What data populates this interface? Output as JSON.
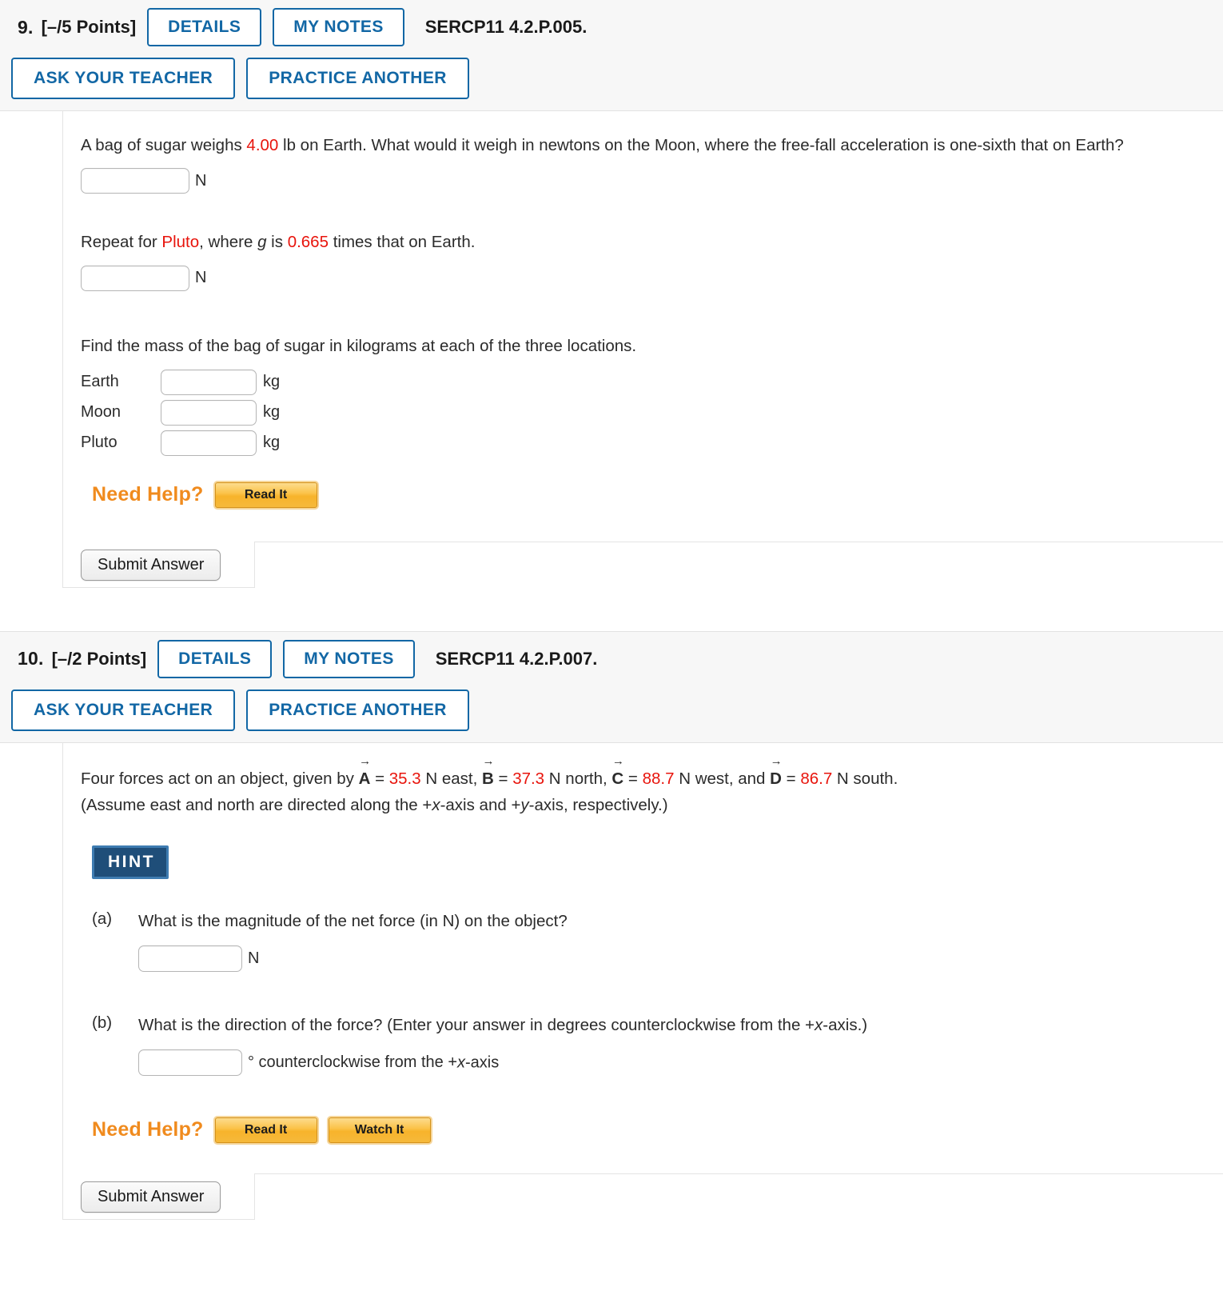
{
  "questions": [
    {
      "number": "9.",
      "points": "[–/5 Points]",
      "details_label": "DETAILS",
      "my_notes_label": "MY NOTES",
      "code": "SERCP11 4.2.P.005.",
      "ask_teacher_label": "ASK YOUR TEACHER",
      "practice_label": "PRACTICE ANOTHER",
      "prompt_1a": "A bag of sugar weighs ",
      "prompt_1_val": "4.00",
      "prompt_1b": " lb on Earth. What would it weigh in newtons on the Moon, where the free-fall acceleration is one-sixth that on Earth?",
      "unit_n": "N",
      "prompt_2a": "Repeat for ",
      "prompt_2_planet": "Pluto",
      "prompt_2b": ", where ",
      "prompt_2_g": "g",
      "prompt_2c": " is ",
      "prompt_2_val": "0.665",
      "prompt_2d": " times that on Earth.",
      "prompt_3": "Find the mass of the bag of sugar in kilograms at each of the three locations.",
      "mass_rows": [
        {
          "label": "Earth",
          "unit": "kg",
          "value": "",
          "highlight": false
        },
        {
          "label": "Moon",
          "unit": "kg",
          "value": "",
          "highlight": false
        },
        {
          "label": "Pluto",
          "unit": "kg",
          "value": "",
          "highlight": true
        }
      ],
      "need_help_label": "Need Help?",
      "help_buttons": [
        "Read It"
      ],
      "submit_label": "Submit Answer"
    },
    {
      "number": "10.",
      "points": "[–/2 Points]",
      "details_label": "DETAILS",
      "my_notes_label": "MY NOTES",
      "code": "SERCP11 4.2.P.007.",
      "ask_teacher_label": "ASK YOUR TEACHER",
      "practice_label": "PRACTICE ANOTHER",
      "prompt_lead": "Four forces act on an object, given by ",
      "vectors": [
        {
          "symbol": "A",
          "value": "35.3",
          "unit_dir": " N east, "
        },
        {
          "symbol": "B",
          "value": "37.3",
          "unit_dir": " N north, "
        },
        {
          "symbol": "C",
          "value": "88.7",
          "unit_dir": " N west, and "
        },
        {
          "symbol": "D",
          "value": "86.7",
          "unit_dir": " N south."
        }
      ],
      "equals": " = ",
      "assume_line_a": "(Assume east and north are directed along the +",
      "assume_x": "x",
      "assume_line_b": "-axis and +",
      "assume_y": "y",
      "assume_line_c": "-axis, respectively.)",
      "hint_label": "HINT",
      "parts": [
        {
          "letter": "(a)",
          "text": "What is the magnitude of the net force (in N) on the object?",
          "unit": "N",
          "value": ""
        },
        {
          "letter": "(b)",
          "text_a": "What is the direction of the force? (Enter your answer in degrees counterclockwise from the +",
          "text_x": "x",
          "text_b": "-axis.)",
          "unit_a": "° counterclockwise from the +",
          "unit_x": "x",
          "unit_b": "-axis",
          "value": ""
        }
      ],
      "need_help_label": "Need Help?",
      "help_buttons": [
        "Read It",
        "Watch It"
      ],
      "submit_label": "Submit Answer"
    }
  ],
  "colors": {
    "accent_blue": "#1267a5",
    "red_value": "#e8140c",
    "orange": "#f08b1e",
    "hint_navy": "#1f4e79"
  }
}
